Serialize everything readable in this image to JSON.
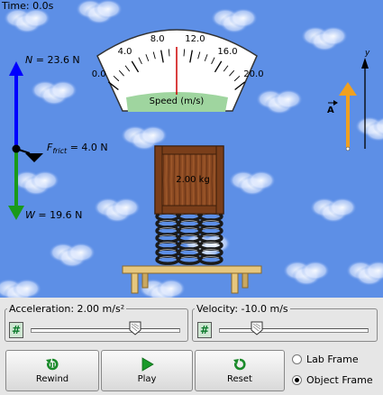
{
  "sim": {
    "time_text": "Time:  0.0s",
    "mass_text": "2.00 kg",
    "forces": {
      "normal": {
        "symbol": "N",
        "value_text": "=  23.6 N",
        "color": "#0000ff"
      },
      "friction": {
        "symbol": "F",
        "sub": "frict",
        "value_text": "= 4.0 N",
        "color": "#000000"
      },
      "weight": {
        "symbol": "W",
        "value_text": "=  19.6 N",
        "color": "#1a9a1a"
      }
    },
    "accel_vector": {
      "letter": "A",
      "color": "#f0a020"
    },
    "axis": {
      "letter": "y"
    }
  },
  "speedometer": {
    "title": "Speed (m/s)",
    "tick_labels": [
      "0.0",
      "4.0",
      "8.0",
      "12.0",
      "16.0",
      "20.0"
    ],
    "value": 10.0,
    "max": 20.0,
    "band_color": "#9fd59f"
  },
  "controls": {
    "acceleration": {
      "legend": "Acceleration: 2.00 m/s²",
      "hash": "#",
      "fraction": 0.7
    },
    "velocity": {
      "legend": "Velocity: -10.0 m/s",
      "hash": "#",
      "fraction": 0.25
    },
    "buttons": {
      "rewind": "Rewind",
      "play": "Play",
      "reset": "Reset"
    },
    "frame": {
      "lab": "Lab Frame",
      "object": "Object Frame",
      "selected": "object"
    }
  }
}
